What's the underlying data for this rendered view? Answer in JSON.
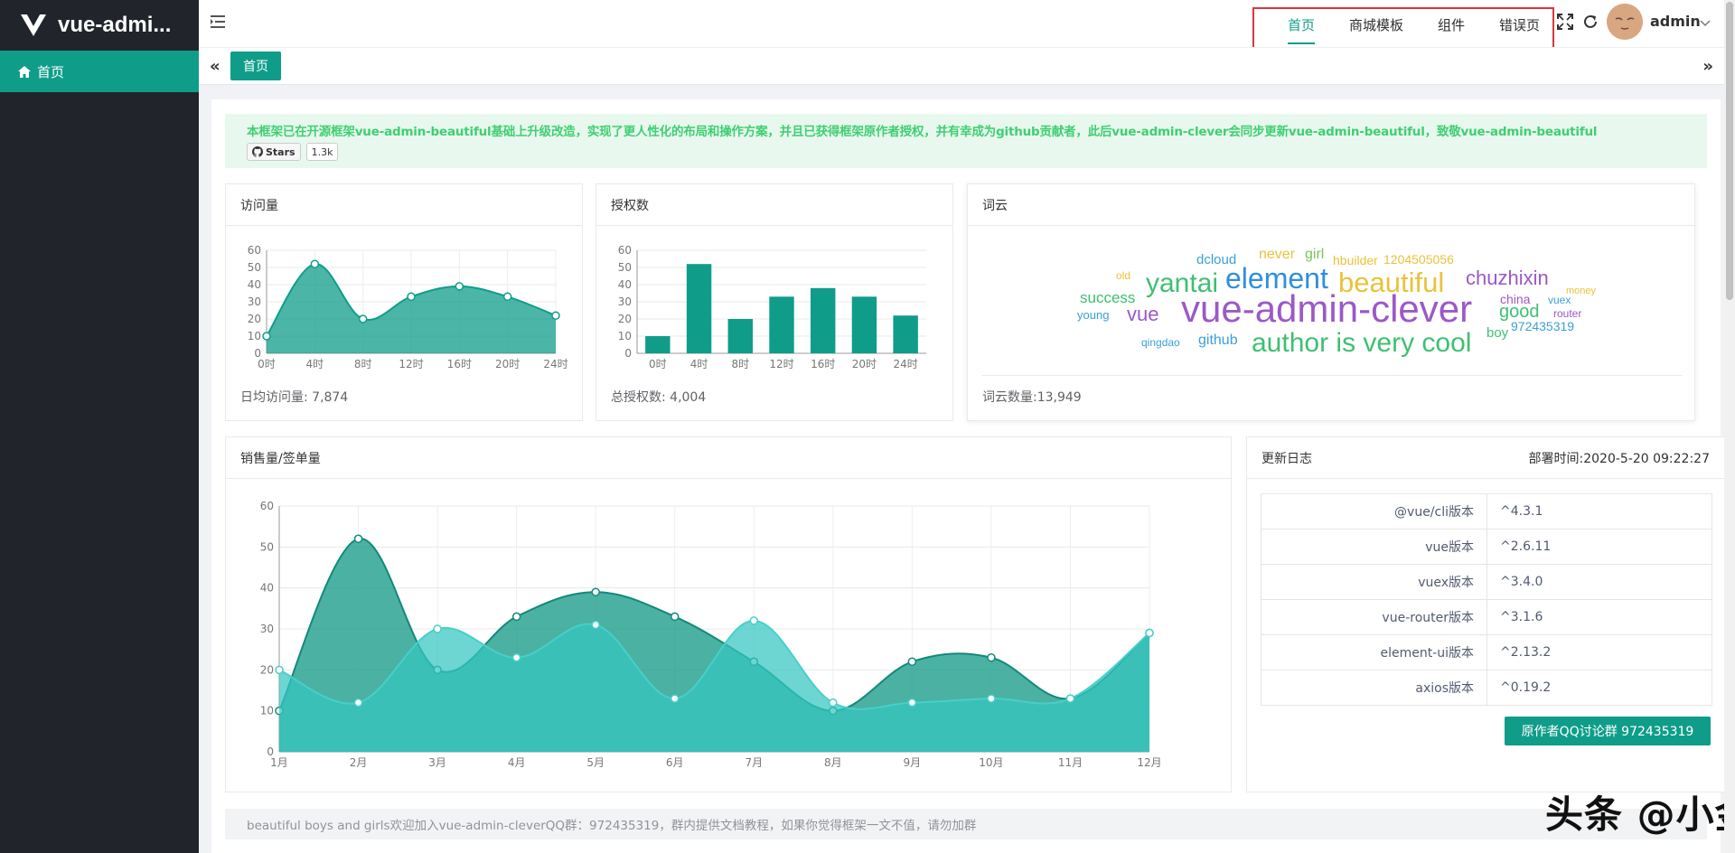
{
  "app": {
    "title": "vue-admi...",
    "accent": "#0f9d8a"
  },
  "sidebar": {
    "items": [
      {
        "label": "首页",
        "icon": "home-icon"
      }
    ]
  },
  "topnav": {
    "items": [
      "首页",
      "商城模板",
      "组件",
      "错误页"
    ],
    "active": 0
  },
  "user": {
    "name": "admin"
  },
  "tabs": {
    "items": [
      "首页"
    ]
  },
  "notice": {
    "text": "本框架已在开源框架vue-admin-beautiful基础上升级改造，实现了更人性化的布局和操作方案，并且已获得框架原作者授权，并有幸成为github贡献者，此后vue-admin-clever会同步更新vue-admin-beautiful，致敬vue-admin-beautiful",
    "stars_label": "Stars",
    "stars_count": "1.3k"
  },
  "visits": {
    "title": "访问量",
    "footer": "日均访问量: 7,874",
    "chart_data": {
      "type": "area",
      "x": [
        "0时",
        "4时",
        "8时",
        "12时",
        "16时",
        "20时",
        "24时"
      ],
      "values": [
        10,
        52,
        20,
        33,
        39,
        33,
        22
      ],
      "ylim": [
        0,
        60
      ],
      "yticks": [
        0,
        10,
        20,
        30,
        40,
        50,
        60
      ]
    }
  },
  "auth": {
    "title": "授权数",
    "footer": "总授权数: 4,004",
    "chart_data": {
      "type": "bar",
      "categories": [
        "0时",
        "4时",
        "8时",
        "12时",
        "16时",
        "20时",
        "24时"
      ],
      "values": [
        10,
        52,
        20,
        33,
        38,
        33,
        22
      ],
      "ylim": [
        0,
        60
      ],
      "yticks": [
        0,
        10,
        20,
        30,
        40,
        50,
        60
      ]
    }
  },
  "wordcloud": {
    "title": "词云",
    "footer": "词云数量:13,949",
    "words": [
      "dcloud",
      "never",
      "girl",
      "hbuilder",
      "1204505056",
      "old",
      "yantai",
      "element",
      "beautiful",
      "chuzhixin",
      "money",
      "success",
      "china",
      "vuex",
      "young",
      "vue",
      "vue-admin-clever",
      "good",
      "router",
      "boy",
      "972435319",
      "qingdao",
      "github",
      "author is very cool"
    ]
  },
  "sales": {
    "title": "销售量/签单量",
    "chart_data": {
      "type": "area",
      "x": [
        "1月",
        "2月",
        "3月",
        "4月",
        "5月",
        "6月",
        "7月",
        "8月",
        "9月",
        "10月",
        "11月",
        "12月"
      ],
      "ylim": [
        0,
        60
      ],
      "yticks": [
        0,
        10,
        20,
        30,
        40,
        50,
        60
      ],
      "series": [
        {
          "values": [
            10,
            52,
            20,
            33,
            39,
            33,
            22,
            10,
            22,
            23,
            13,
            29
          ]
        },
        {
          "values": [
            20,
            12,
            30,
            23,
            31,
            13,
            32,
            12,
            12,
            13,
            13,
            29
          ]
        }
      ]
    }
  },
  "changelog": {
    "title": "更新日志",
    "deploy": "部署时间:2020-5-20 09:22:27",
    "rows": [
      {
        "k": "@vue/cli版本",
        "v": "^4.3.1"
      },
      {
        "k": "vue版本",
        "v": "^2.6.11"
      },
      {
        "k": "vuex版本",
        "v": "^3.4.0"
      },
      {
        "k": "vue-router版本",
        "v": "^3.1.6"
      },
      {
        "k": "element-ui版本",
        "v": "^2.13.2"
      },
      {
        "k": "axios版本",
        "v": "^0.19.2"
      }
    ],
    "qq_button": "原作者QQ讨论群 972435319"
  },
  "bottom_notice": "beautiful boys and girls欢迎加入vue-admin-cleverQQ群：972435319，群内提供文档教程，如果你觉得框架一文不值，请勿加群",
  "watermark": "头条 @小金说前端"
}
